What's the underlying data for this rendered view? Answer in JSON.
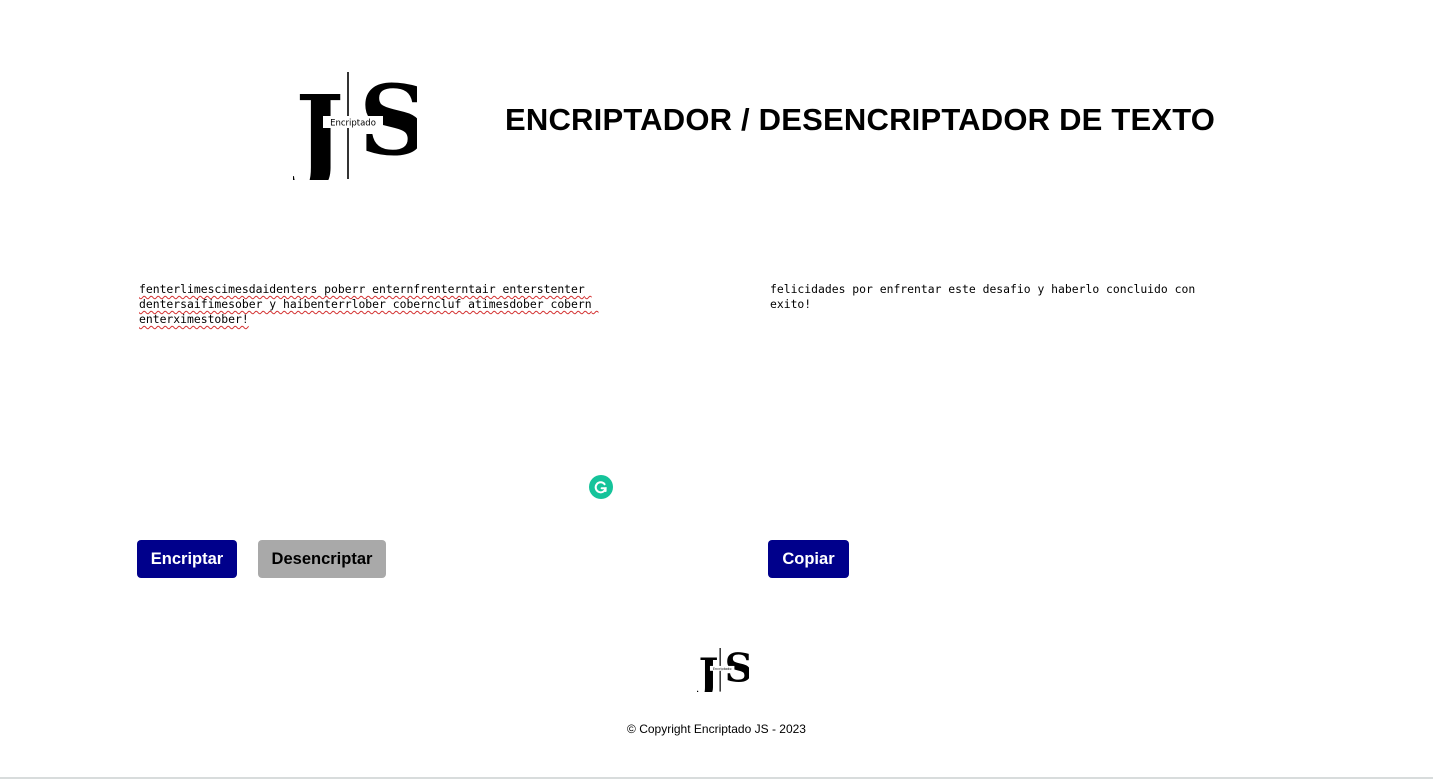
{
  "header": {
    "logo_letters": "JS",
    "logo_caption": "Encriptado",
    "title": "ENCRIPTADOR / DESENCRIPTADOR DE TEXTO"
  },
  "input": {
    "value": "fenterlimescimesdaidenters poberr enternfrenterntair enterstenter dentersaifimesober y haibenterrlober coberncluf atimesdober cobern enterximestober!"
  },
  "output": {
    "value": "felicidades por enfrentar este desafio y haberlo concluido con exito!"
  },
  "buttons": {
    "encrypt_label": "Encriptar",
    "decrypt_label": "Desencriptar",
    "copy_label": "Copiar"
  },
  "footer": {
    "copyright": "© Copyright Encriptado JS - 2023"
  },
  "colors": {
    "primary_button": "#00008b",
    "secondary_button": "#a9a9a9",
    "grammarly": "#15c39a"
  },
  "icons": {
    "grammarly": "grammarly-icon"
  }
}
